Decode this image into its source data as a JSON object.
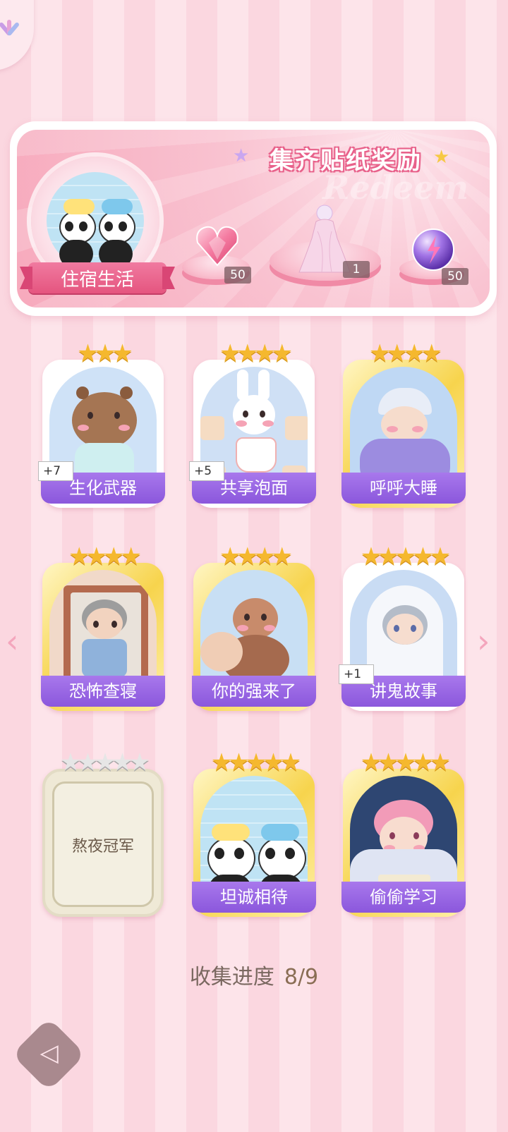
{
  "banner": {
    "title": "集齐贴纸奖励",
    "watermark": "Redeem",
    "theme_label": "住宿生活",
    "rewards": [
      {
        "icon": "pink-heart-gem-icon",
        "count": "50"
      },
      {
        "icon": "costume-figure-icon",
        "count": "1"
      },
      {
        "icon": "purple-energy-orb-icon",
        "count": "50"
      }
    ]
  },
  "cards": [
    {
      "name": "生化武器",
      "stars": 3,
      "extra": "+7",
      "frame": "white",
      "art": "capybara-pajamas"
    },
    {
      "name": "共享泡面",
      "stars": 4,
      "extra": "+5",
      "frame": "white",
      "art": "bunny-noodles"
    },
    {
      "name": "呼呼大睡",
      "stars": 4,
      "extra": "",
      "frame": "gold",
      "art": "sleeping-boy"
    },
    {
      "name": "恐怖查寝",
      "stars": 4,
      "extra": "",
      "frame": "gold",
      "art": "dorm-auntie"
    },
    {
      "name": "你的强来了",
      "stars": 4,
      "extra": "",
      "frame": "gold",
      "art": "cockroach"
    },
    {
      "name": "讲鬼故事",
      "stars": 5,
      "extra": "+1",
      "frame": "white",
      "art": "ghost-boy"
    },
    {
      "name": "熬夜冠军",
      "stars": 5,
      "extra": "",
      "frame": "locked",
      "art": "locked"
    },
    {
      "name": "坦诚相待",
      "stars": 5,
      "extra": "",
      "frame": "gold",
      "art": "bathing-pandas"
    },
    {
      "name": "偷偷学习",
      "stars": 5,
      "extra": "",
      "frame": "gold",
      "art": "studying-boy"
    }
  ],
  "stars_text": {
    "3": "★★★",
    "4": "★★★★",
    "5": "★★★★★"
  },
  "progress": {
    "label": "收集进度",
    "value": "8/9",
    "collected": 8,
    "total": 9
  },
  "nav": {
    "prev_icon": "chevron-left-icon",
    "next_icon": "chevron-right-icon"
  },
  "colors": {
    "accent_purple": "#8b57dc",
    "banner_pink": "#f7a9bc",
    "star_gold": "#f5b82e"
  }
}
